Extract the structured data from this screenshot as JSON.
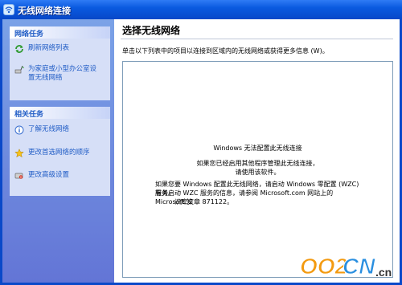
{
  "window": {
    "title": "无线网络连接",
    "app_icon": "wireless-network-icon"
  },
  "sidebar": {
    "network_tasks": {
      "header": "网络任务",
      "items": [
        {
          "label": "刷新网络列表",
          "icon": "refresh-icon"
        },
        {
          "label_line1": "为家庭或小型办公室设",
          "label_line2": "置无线网络",
          "icon": "wireless-setup-icon"
        }
      ]
    },
    "related_tasks": {
      "header": "相关任务",
      "items": [
        {
          "label": "了解无线网络",
          "icon": "info-icon"
        },
        {
          "label": "更改首选网络的顺序",
          "icon": "star-icon"
        },
        {
          "label": "更改高级设置",
          "icon": "settings-icon"
        }
      ]
    }
  },
  "main": {
    "heading": "选择无线网络",
    "instruction": "单击以下列表中的项目以连接到区域内的无线网络或获得更多信息 (W)。",
    "message": {
      "line1": "Windows 无法配置此无线连接",
      "line2a": "如果您已经启用其他程序管理此无线连接，",
      "line2b": "请使用该软件。",
      "line3a": "如果您要 Windows 配置此无线网络，请启动 Windows 零配置 (WZC) 服务。",
      "line3b": "有关启动 WZC 服务的信息，请参阅 Microsoft.com 网站上的 Microsoft 知",
      "line3c": "识库文章 871122。"
    }
  },
  "watermark": {
    "text_left": "OO2",
    "text_mid": "CN",
    "text_right": ".cn"
  },
  "colors": {
    "titlebar": "#0a5ae0",
    "sidepane": "#7ba2e7",
    "task_link": "#215dc6",
    "group_bg": "#d6dff7"
  }
}
